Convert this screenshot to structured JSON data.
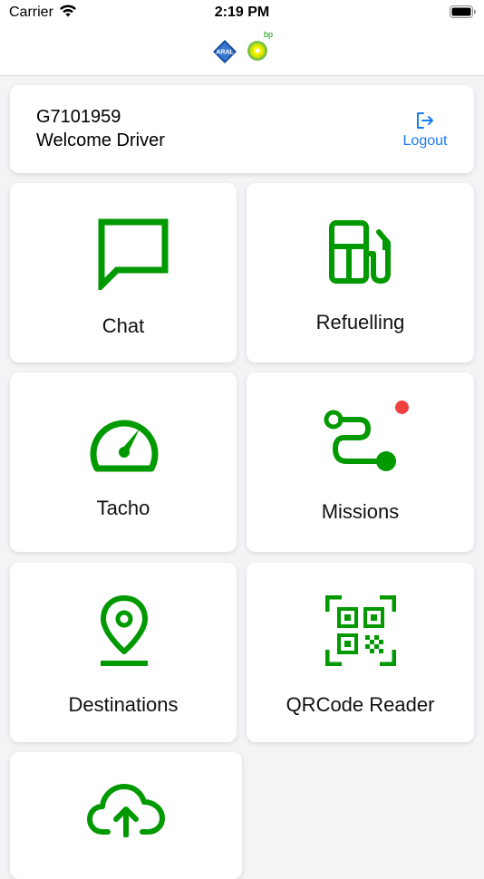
{
  "status_bar": {
    "carrier": "Carrier",
    "time": "2:19 PM"
  },
  "header": {
    "logo_left": "ARAL",
    "logo_right": "bp"
  },
  "user": {
    "id": "G7101959",
    "welcome": "Welcome Driver",
    "logout_label": "Logout"
  },
  "tiles": [
    {
      "label": "Chat",
      "icon": "chat-bubble-icon"
    },
    {
      "label": "Refuelling",
      "icon": "fuel-pump-icon"
    },
    {
      "label": "Tacho",
      "icon": "speedometer-icon"
    },
    {
      "label": "Missions",
      "icon": "route-icon",
      "has_notification": true
    },
    {
      "label": "Destinations",
      "icon": "map-pin-icon"
    },
    {
      "label": "QRCode Reader",
      "icon": "qr-code-icon"
    },
    {
      "label": "",
      "icon": "cloud-upload-icon"
    }
  ],
  "colors": {
    "accent_green": "#009900",
    "link_blue": "#1a7cf5",
    "notification_red": "#ef4040",
    "background": "#f4f4f6"
  }
}
